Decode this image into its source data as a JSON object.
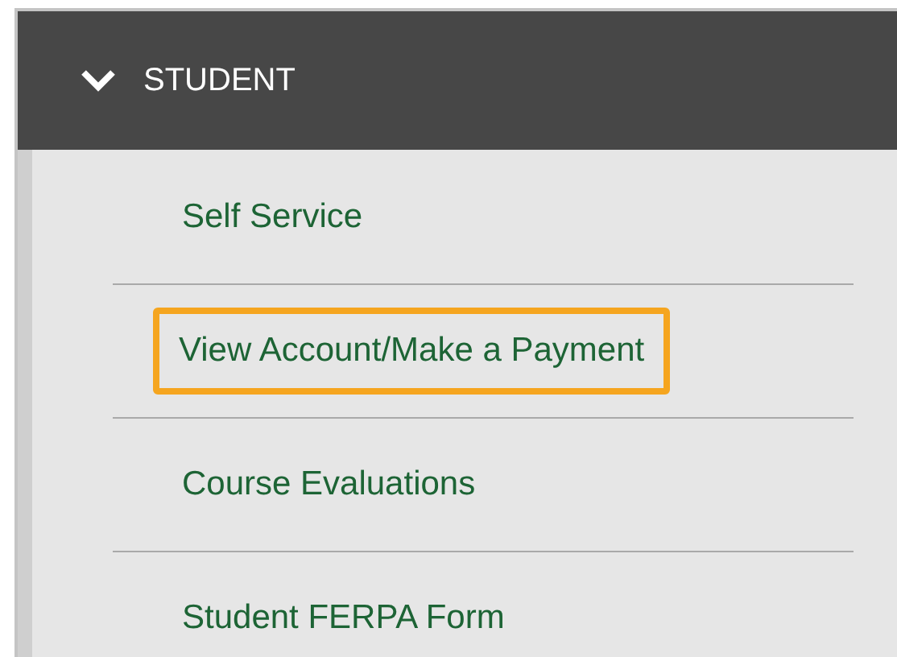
{
  "section": {
    "title": "STUDENT",
    "expanded": true
  },
  "items": [
    {
      "label": "Self Service",
      "highlighted": false
    },
    {
      "label": "View Account/Make a Payment",
      "highlighted": true
    },
    {
      "label": "Course Evaluations",
      "highlighted": false
    },
    {
      "label": "Student FERPA Form",
      "highlighted": false
    }
  ]
}
